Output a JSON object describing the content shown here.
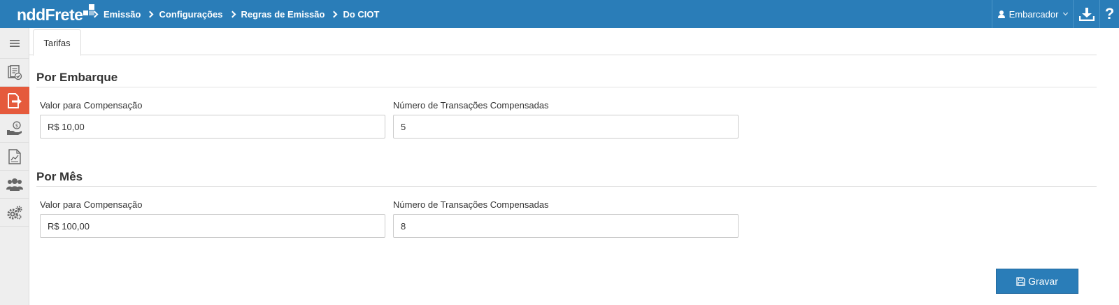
{
  "app": {
    "logo_text": "nddFrete"
  },
  "breadcrumb": [
    {
      "label": "Emissão"
    },
    {
      "label": "Configurações"
    },
    {
      "label": "Regras de Emissão"
    },
    {
      "label": "Do CIOT"
    }
  ],
  "header": {
    "user_label": "Embarcador",
    "help_label": "?"
  },
  "tabs": [
    {
      "label": "Tarifas",
      "active": true
    }
  ],
  "sections": {
    "embarque": {
      "title": "Por Embarque",
      "valor_label": "Valor para Compensação",
      "valor_value": "R$ 10,00",
      "transacoes_label": "Número de Transações Compensadas",
      "transacoes_value": "5"
    },
    "mes": {
      "title": "Por Mês",
      "valor_label": "Valor para Compensação",
      "valor_value": "R$ 100,00",
      "transacoes_label": "Número de Transações Compensadas",
      "transacoes_value": "8"
    }
  },
  "actions": {
    "save_label": "Gravar"
  },
  "colors": {
    "primary": "#2a7db8",
    "active_nav": "#e55a3c"
  },
  "sidebar": {
    "items": [
      {
        "icon": "menu-icon",
        "active": false
      },
      {
        "icon": "document-check-icon",
        "active": false
      },
      {
        "icon": "document-export-icon",
        "active": true
      },
      {
        "icon": "hand-money-icon",
        "active": false
      },
      {
        "icon": "report-chart-icon",
        "active": false
      },
      {
        "icon": "users-icon",
        "active": false
      },
      {
        "icon": "gears-icon",
        "active": false
      }
    ]
  }
}
